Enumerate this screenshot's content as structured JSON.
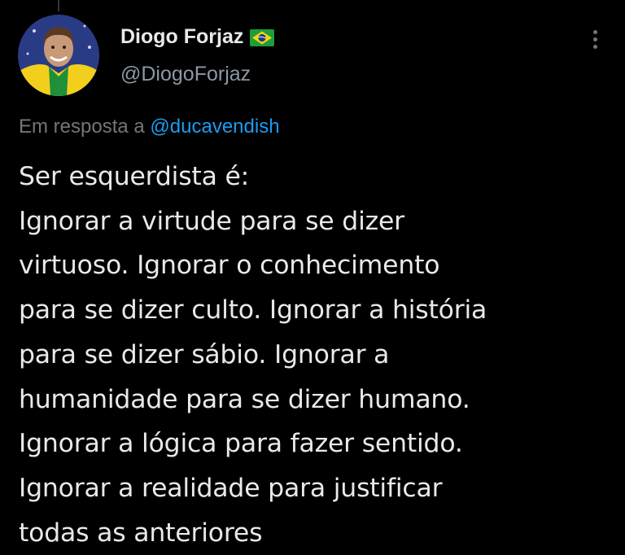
{
  "author": {
    "display_name": "Diogo Forjaz",
    "handle": "@DiogoForjaz",
    "verified_flag_icon": "brazil-flag-icon"
  },
  "reply": {
    "prefix": "Em resposta a",
    "mention": "@ducavendish"
  },
  "tweet": {
    "lines": [
      "Ser esquerdista é:",
      "Ignorar a virtude para se dizer",
      "virtuoso. Ignorar o conhecimento",
      "para se dizer culto. Ignorar a história",
      "para se dizer sábio. Ignorar a",
      "humanidade para se dizer humano.",
      "Ignorar a lógica para fazer sentido.",
      "Ignorar a realidade para justificar",
      "todas as anteriores"
    ]
  },
  "icons": {
    "more": "more-options-icon"
  },
  "colors": {
    "background": "#000000",
    "text": "#e7e9ea",
    "secondary": "#71767b",
    "link": "#1d9bf0"
  }
}
